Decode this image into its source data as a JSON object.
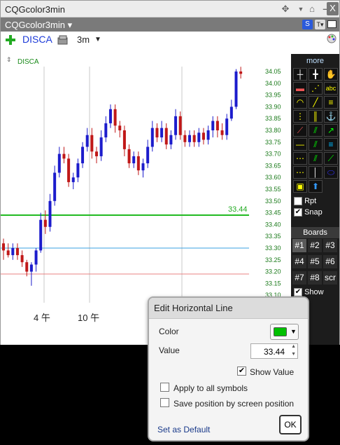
{
  "window": {
    "title": "CQGcolor3min",
    "tab_label": "CQGcolor3min ▾",
    "s_badge": "S",
    "t_badge": "T▾"
  },
  "symbol_bar": {
    "symbol": "DISCA",
    "interval": "3m"
  },
  "chart": {
    "label": "DISCA",
    "price_ticks": [
      "34.05",
      "34.00",
      "33.95",
      "33.90",
      "33.85",
      "33.80",
      "33.75",
      "33.70",
      "33.65",
      "33.60",
      "33.55",
      "33.50",
      "33.45",
      "33.40",
      "33.35",
      "33.30",
      "33.25",
      "33.20",
      "33.15",
      "33.10"
    ],
    "time_labels": [
      "4 午",
      "10 午"
    ],
    "hline_label": "33.44",
    "colors": {
      "up": "#1c1ccc",
      "down": "#c01818",
      "green_line": "#22bb22",
      "blue_line": "#3aa0e0",
      "red_line": "#e88080"
    },
    "candles": [
      {
        "o": 33.32,
        "c": 33.29,
        "h": 33.34,
        "l": 33.25
      },
      {
        "o": 33.29,
        "c": 33.27,
        "h": 33.32,
        "l": 33.26
      },
      {
        "o": 33.27,
        "c": 33.3,
        "h": 33.32,
        "l": 33.25
      },
      {
        "o": 33.3,
        "c": 33.27,
        "h": 33.32,
        "l": 33.25
      },
      {
        "o": 33.27,
        "c": 33.24,
        "h": 33.29,
        "l": 33.22
      },
      {
        "o": 33.24,
        "c": 33.2,
        "h": 33.25,
        "l": 33.18
      },
      {
        "o": 33.2,
        "c": 33.23,
        "h": 33.24,
        "l": 33.14
      },
      {
        "o": 33.23,
        "c": 33.29,
        "h": 33.3,
        "l": 33.2
      },
      {
        "o": 33.29,
        "c": 33.42,
        "h": 33.45,
        "l": 33.28
      },
      {
        "o": 33.42,
        "c": 33.39,
        "h": 33.46,
        "l": 33.36
      },
      {
        "o": 33.39,
        "c": 33.5,
        "h": 33.53,
        "l": 33.37
      },
      {
        "o": 33.5,
        "c": 33.62,
        "h": 33.65,
        "l": 33.48
      },
      {
        "o": 33.62,
        "c": 33.7,
        "h": 33.73,
        "l": 33.6
      },
      {
        "o": 33.7,
        "c": 33.68,
        "h": 33.73,
        "l": 33.66
      },
      {
        "o": 33.68,
        "c": 33.58,
        "h": 33.7,
        "l": 33.56
      },
      {
        "o": 33.58,
        "c": 33.6,
        "h": 33.62,
        "l": 33.55
      },
      {
        "o": 33.6,
        "c": 33.66,
        "h": 33.68,
        "l": 33.58
      },
      {
        "o": 33.66,
        "c": 33.73,
        "h": 33.75,
        "l": 33.64
      },
      {
        "o": 33.73,
        "c": 33.78,
        "h": 33.81,
        "l": 33.71
      },
      {
        "o": 33.78,
        "c": 33.71,
        "h": 33.81,
        "l": 33.68
      },
      {
        "o": 33.71,
        "c": 33.69,
        "h": 33.73,
        "l": 33.66
      },
      {
        "o": 33.69,
        "c": 33.77,
        "h": 33.8,
        "l": 33.67
      },
      {
        "o": 33.77,
        "c": 33.83,
        "h": 33.86,
        "l": 33.75
      },
      {
        "o": 33.83,
        "c": 33.89,
        "h": 33.91,
        "l": 33.81
      },
      {
        "o": 33.89,
        "c": 33.82,
        "h": 33.91,
        "l": 33.79
      },
      {
        "o": 33.82,
        "c": 33.8,
        "h": 33.84,
        "l": 33.77
      },
      {
        "o": 33.8,
        "c": 33.72,
        "h": 33.82,
        "l": 33.69
      },
      {
        "o": 33.72,
        "c": 33.66,
        "h": 33.74,
        "l": 33.64
      },
      {
        "o": 33.66,
        "c": 33.69,
        "h": 33.71,
        "l": 33.64
      },
      {
        "o": 33.69,
        "c": 33.63,
        "h": 33.71,
        "l": 33.61
      },
      {
        "o": 33.63,
        "c": 33.66,
        "h": 33.68,
        "l": 33.6
      },
      {
        "o": 33.66,
        "c": 33.73,
        "h": 33.76,
        "l": 33.64
      },
      {
        "o": 33.73,
        "c": 33.81,
        "h": 33.84,
        "l": 33.71
      },
      {
        "o": 33.81,
        "c": 33.77,
        "h": 33.83,
        "l": 33.75
      },
      {
        "o": 33.77,
        "c": 33.81,
        "h": 33.84,
        "l": 33.75
      },
      {
        "o": 33.81,
        "c": 33.74,
        "h": 33.83,
        "l": 33.72
      },
      {
        "o": 33.74,
        "c": 33.78,
        "h": 33.8,
        "l": 33.72
      },
      {
        "o": 33.78,
        "c": 33.86,
        "h": 33.89,
        "l": 33.76
      },
      {
        "o": 33.86,
        "c": 33.78,
        "h": 33.88,
        "l": 33.76
      },
      {
        "o": 33.78,
        "c": 33.75,
        "h": 33.8,
        "l": 33.73
      },
      {
        "o": 33.75,
        "c": 33.78,
        "h": 33.8,
        "l": 33.73
      },
      {
        "o": 33.78,
        "c": 33.75,
        "h": 33.8,
        "l": 33.73
      },
      {
        "o": 33.75,
        "c": 33.79,
        "h": 33.81,
        "l": 33.73
      },
      {
        "o": 33.79,
        "c": 33.76,
        "h": 33.81,
        "l": 33.74
      },
      {
        "o": 33.76,
        "c": 33.8,
        "h": 33.82,
        "l": 33.74
      },
      {
        "o": 33.8,
        "c": 33.84,
        "h": 33.86,
        "l": 33.77
      },
      {
        "o": 33.84,
        "c": 33.8,
        "h": 33.86,
        "l": 33.77
      },
      {
        "o": 33.8,
        "c": 33.78,
        "h": 33.83,
        "l": 33.76
      },
      {
        "o": 33.78,
        "c": 33.85,
        "h": 33.87,
        "l": 33.76
      },
      {
        "o": 33.85,
        "c": 33.9,
        "h": 33.93,
        "l": 33.84
      },
      {
        "o": 33.9,
        "c": 34.05,
        "h": 34.06,
        "l": 33.89
      },
      {
        "o": 34.05,
        "c": 34.04,
        "h": 34.07,
        "l": 34.02
      }
    ],
    "hlines": [
      33.44,
      33.3,
      33.19
    ]
  },
  "tool_panel": {
    "more_label": "more",
    "rpt_label": "Rpt",
    "snap_label": "Snap",
    "snap_checked": true,
    "boards_label": "Boards",
    "boards": [
      "#1",
      "#2",
      "#3",
      "#4",
      "#5",
      "#6",
      "#7",
      "#8",
      "scr"
    ],
    "show_label": "Show",
    "show_checked": true
  },
  "dialog": {
    "title": "Edit Horizontal Line",
    "color_label": "Color",
    "color_value": "#00c000",
    "value_label": "Value",
    "value": "33.44",
    "show_value_label": "Show Value",
    "show_value_checked": true,
    "apply_all_label": "Apply to all symbols",
    "save_position_label": "Save position by screen position",
    "set_default_label": "Set as Default",
    "ok_label": "OK"
  }
}
